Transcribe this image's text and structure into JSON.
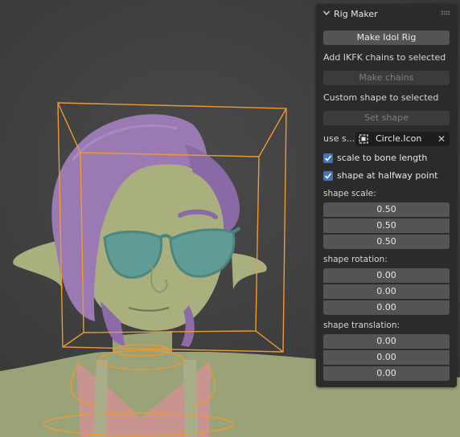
{
  "panel": {
    "title": "Rig Maker",
    "make_idol_rig": "Make Idol Rig",
    "ikfk_label": "Add IKFK chains to selected",
    "make_chains": "Make chains",
    "custom_shape_label": "Custom shape to selected",
    "set_shape": "Set shape",
    "use_shape_label": "use s...",
    "shape_object": "Circle.Icon",
    "clear_symbol": "✕",
    "scale_to_bone_length": "scale to bone length",
    "shape_at_halfway": "shape at halfway point",
    "shape_scale_label": "shape scale:",
    "shape_scale": [
      "0.50",
      "0.50",
      "0.50"
    ],
    "shape_rotation_label": "shape rotation:",
    "shape_rotation": [
      "0.00",
      "0.00",
      "0.00"
    ],
    "shape_translation_label": "shape translation:",
    "shape_translation": [
      "0.00",
      "0.00",
      "0.00"
    ],
    "checkbox_color": "#4772b3"
  },
  "icons": {
    "collapse": "chevron-down-icon",
    "drag": "drag-grip-icon",
    "object": "object-icon",
    "clear": "clear-icon",
    "check": "checkmark-icon"
  }
}
